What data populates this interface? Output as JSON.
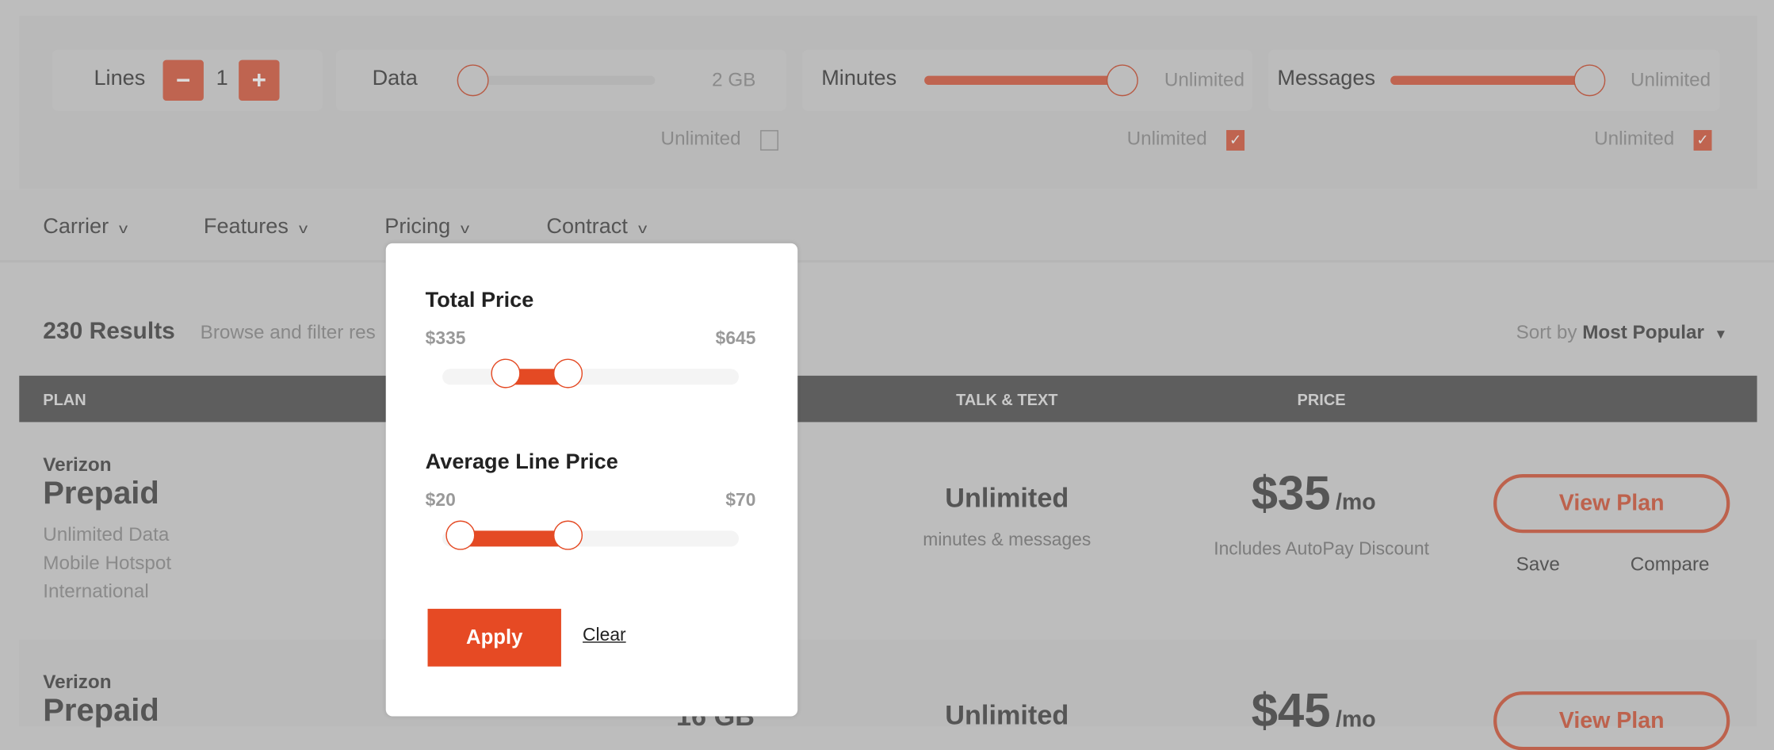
{
  "colors": {
    "accent": "#e64a24",
    "overlay": "#bdbdbd",
    "table_header": "#5e5e5e"
  },
  "top_filters": {
    "lines": {
      "label": "Lines",
      "value": "1",
      "minus": "−",
      "plus": "+"
    },
    "data": {
      "label": "Data",
      "value": "2 GB",
      "unlimited_label": "Unlimited",
      "unlimited_checked": false,
      "level": 0
    },
    "minutes": {
      "label": "Minutes",
      "value": "Unlimited",
      "unlimited_label": "Unlimited",
      "unlimited_checked": true,
      "level": 1
    },
    "messages": {
      "label": "Messages",
      "value": "Unlimited",
      "unlimited_label": "Unlimited",
      "unlimited_checked": true,
      "level": 1
    }
  },
  "filter_bar": [
    {
      "label": "Carrier",
      "icon": "chevron-down-icon"
    },
    {
      "label": "Features",
      "icon": "chevron-down-icon"
    },
    {
      "label": "Pricing",
      "icon": "chevron-down-icon"
    },
    {
      "label": "Contract",
      "icon": "chevron-down-icon"
    }
  ],
  "results": {
    "count": "230 Results",
    "subtitle": "Browse and filter res",
    "sort_label": "Sort by",
    "sort_value": "Most Popular"
  },
  "table": {
    "headers": [
      "PLAN",
      "TALK & TEXT",
      "PRICE"
    ],
    "rows": [
      {
        "carrier": "Verizon",
        "plan": "Prepaid",
        "features": [
          "Unlimited Data",
          "Mobile Hotspot",
          "International"
        ],
        "talk": "Unlimited",
        "talk_sub": "minutes & messages",
        "price": "$35",
        "per": "/mo",
        "price_note": "Includes AutoPay Discount",
        "view": "View Plan",
        "save": "Save",
        "compare": "Compare"
      },
      {
        "carrier": "Verizon",
        "plan": "Prepaid",
        "data": "16 GB",
        "talk": "Unlimited",
        "price": "$45",
        "per": "/mo",
        "view": "View Plan"
      }
    ]
  },
  "pricing_popup": {
    "total": {
      "title": "Total Price",
      "min_label": "$335",
      "max_label": "$645"
    },
    "average": {
      "title": "Average Line Price",
      "min_label": "$20",
      "max_label": "$70"
    },
    "apply": "Apply",
    "clear": "Clear"
  }
}
